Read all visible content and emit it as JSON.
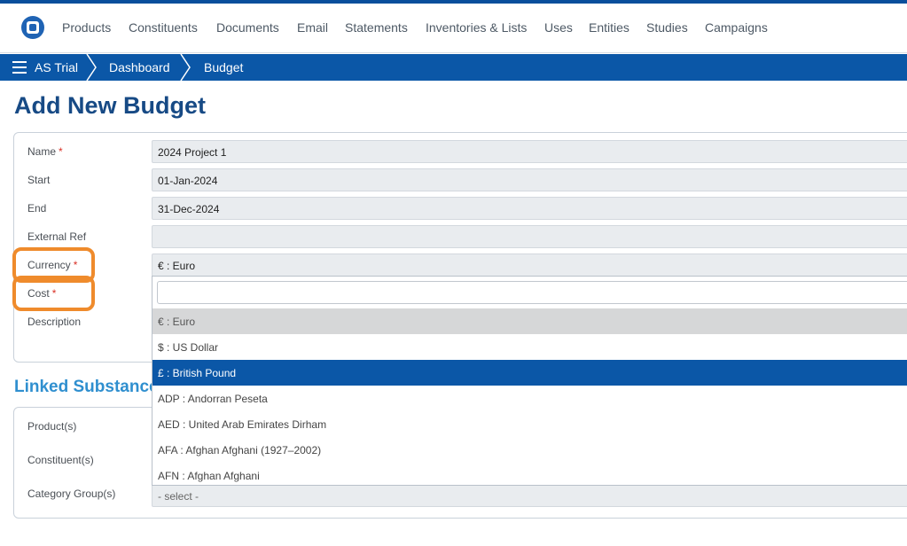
{
  "nav": {
    "items": [
      "Products",
      "Constituents",
      "Documents",
      "Email",
      "Statements",
      "Inventories & Lists",
      "Uses",
      "Entities",
      "Studies",
      "Campaigns"
    ]
  },
  "breadcrumb": [
    "AS Trial",
    "Dashboard",
    "Budget"
  ],
  "page_title": "Add New Budget",
  "form": {
    "name_label": "Name",
    "name_value": "2024 Project 1",
    "start_label": "Start",
    "start_value": "01-Jan-2024",
    "end_label": "End",
    "end_value": "31-Dec-2024",
    "external_ref_label": "External Ref",
    "external_ref_value": "",
    "currency_label": "Currency",
    "currency_value": "€ : Euro",
    "cost_label": "Cost",
    "description_label": "Description",
    "required_marker": "*"
  },
  "currency_dropdown": {
    "search_value": "",
    "options": [
      "€ : Euro",
      "$ : US Dollar",
      "£ : British Pound",
      "ADP : Andorran Peseta",
      "AED : United Arab Emirates Dirham",
      "AFA : Afghan Afghani (1927–2002)",
      "AFN : Afghan Afghani"
    ]
  },
  "linked_section": {
    "title": "Linked Substance",
    "products_label": "Product(s)",
    "constituents_label": "Constituent(s)",
    "category_groups_label": "Category Group(s)",
    "category_groups_placeholder": "- select -"
  },
  "colors": {
    "brand_blue": "#0b57a7",
    "highlight_orange": "#ef8b2c",
    "title_blue": "#174a85",
    "section_blue": "#2f8fcf"
  }
}
